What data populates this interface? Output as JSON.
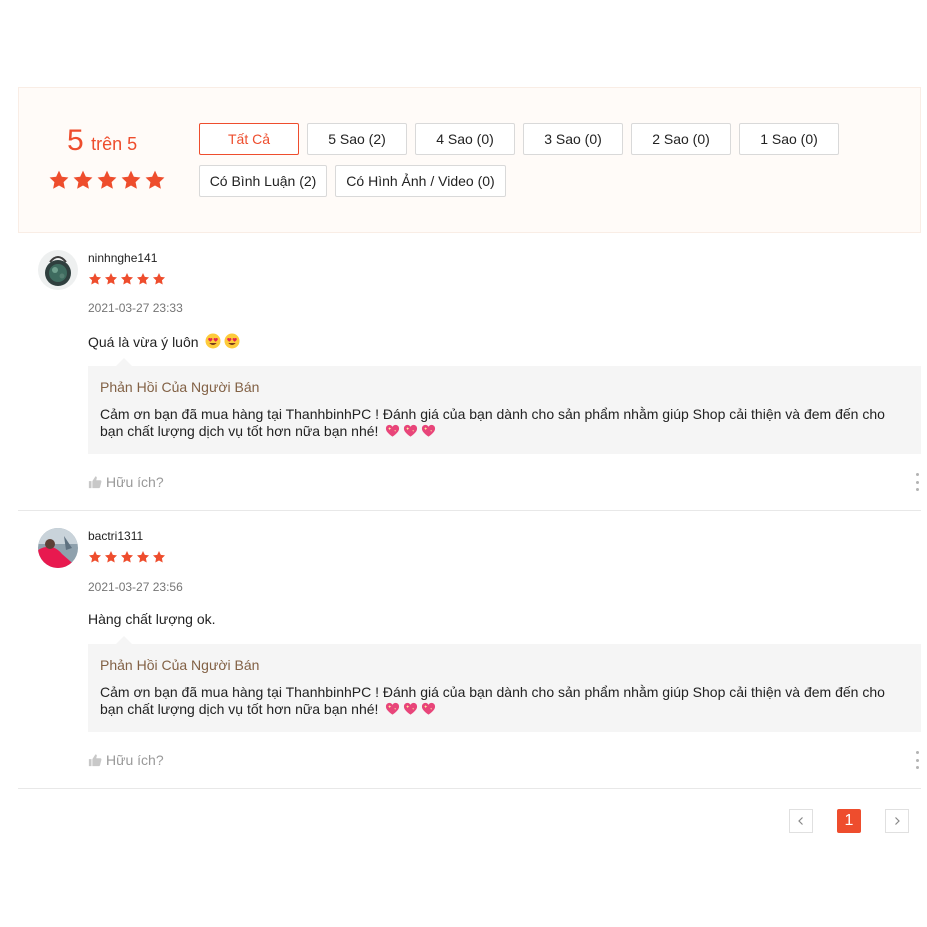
{
  "summary": {
    "score": "5",
    "score_suffix": "trên 5",
    "rating_value": 5,
    "rating_max": 5,
    "filters": [
      "Tất Cả",
      "5 Sao (2)",
      "4 Sao (0)",
      "3 Sao (0)",
      "2 Sao (0)",
      "1 Sao (0)",
      "Có Bình Luận (2)",
      "Có Hình Ảnh / Video (0)"
    ],
    "active_filter": "Tất Cả"
  },
  "reviews": [
    {
      "username": "ninhnghe141",
      "rating": 5,
      "date": "2021-03-27 23:33",
      "comment": "Quá là vừa ý luôn",
      "comment_icons": [
        "heart-eyes-emoji",
        "heart-eyes-emoji"
      ],
      "reply": {
        "title": "Phản Hồi Của Người Bán",
        "text": "Cảm ơn bạn đã mua hàng tại ThanhbinhPC ! Đánh giá của bạn dành cho sản phẩm nhằm giúp Shop cải thiện và đem đến cho bạn chất lượng dịch vụ tốt hơn nữa bạn nhé!",
        "icons": [
          "sparkling-heart-icon",
          "sparkling-heart-icon",
          "sparkling-heart-icon"
        ]
      },
      "helpful_label": "Hữu ích?"
    },
    {
      "username": "bactri1311",
      "rating": 5,
      "date": "2021-03-27 23:56",
      "comment": "Hàng chất lượng ok.",
      "comment_icons": [],
      "reply": {
        "title": "Phản Hồi Của Người Bán",
        "text": "Cảm ơn bạn đã mua hàng tại ThanhbinhPC ! Đánh giá của bạn dành cho sản phẩm nhằm giúp Shop cải thiện và đem đến cho bạn chất lượng dịch vụ tốt hơn nữa bạn nhé!",
        "icons": [
          "sparkling-heart-icon",
          "sparkling-heart-icon",
          "sparkling-heart-icon"
        ]
      },
      "helpful_label": "Hữu ích?"
    }
  ],
  "pagination": {
    "current_page": "1",
    "prev_icon": "chevron-left-icon",
    "next_icon": "chevron-right-icon"
  },
  "colors": {
    "accent": "#ee4d2d",
    "summary_bg": "#fffbf8",
    "reply_bg": "#f5f5f5",
    "reply_title": "#826145",
    "muted_text": "#757575",
    "heart": "#e8457a"
  }
}
